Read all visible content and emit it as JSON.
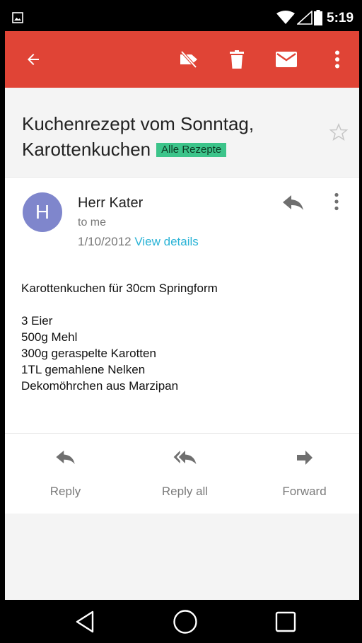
{
  "status_bar": {
    "time": "5:19",
    "icons": [
      "gallery-icon",
      "wifi-icon",
      "signal-icon",
      "battery-icon"
    ]
  },
  "toolbar": {
    "icons": [
      "back-arrow-icon",
      "label-off-icon",
      "delete-icon",
      "mail-icon",
      "more-vert-icon"
    ]
  },
  "email": {
    "subject": "Kuchenrezept vom Sonntag, Karottenkuchen",
    "label": "Alle Rezepte",
    "sender": {
      "initial": "H",
      "name": "Herr Kater",
      "recipient": "to me",
      "date": "1/10/2012",
      "view_details": "View details"
    },
    "body": {
      "intro": "Karottenkuchen für 30cm Springform",
      "ingredients": [
        "3 Eier",
        "500g Mehl",
        "300g geraspelte Karotten",
        "1TL gemahlene Nelken",
        "Dekomöhrchen aus Marzipan"
      ]
    }
  },
  "actions": {
    "reply": "Reply",
    "reply_all": "Reply all",
    "forward": "Forward"
  },
  "colors": {
    "toolbar": "#e04436",
    "label_chip": "#3cc48a",
    "avatar": "#7f86cc",
    "link": "#2ab3d6"
  },
  "nav_bar": {
    "icons": [
      "back-triangle-icon",
      "home-circle-icon",
      "recents-square-icon"
    ]
  }
}
